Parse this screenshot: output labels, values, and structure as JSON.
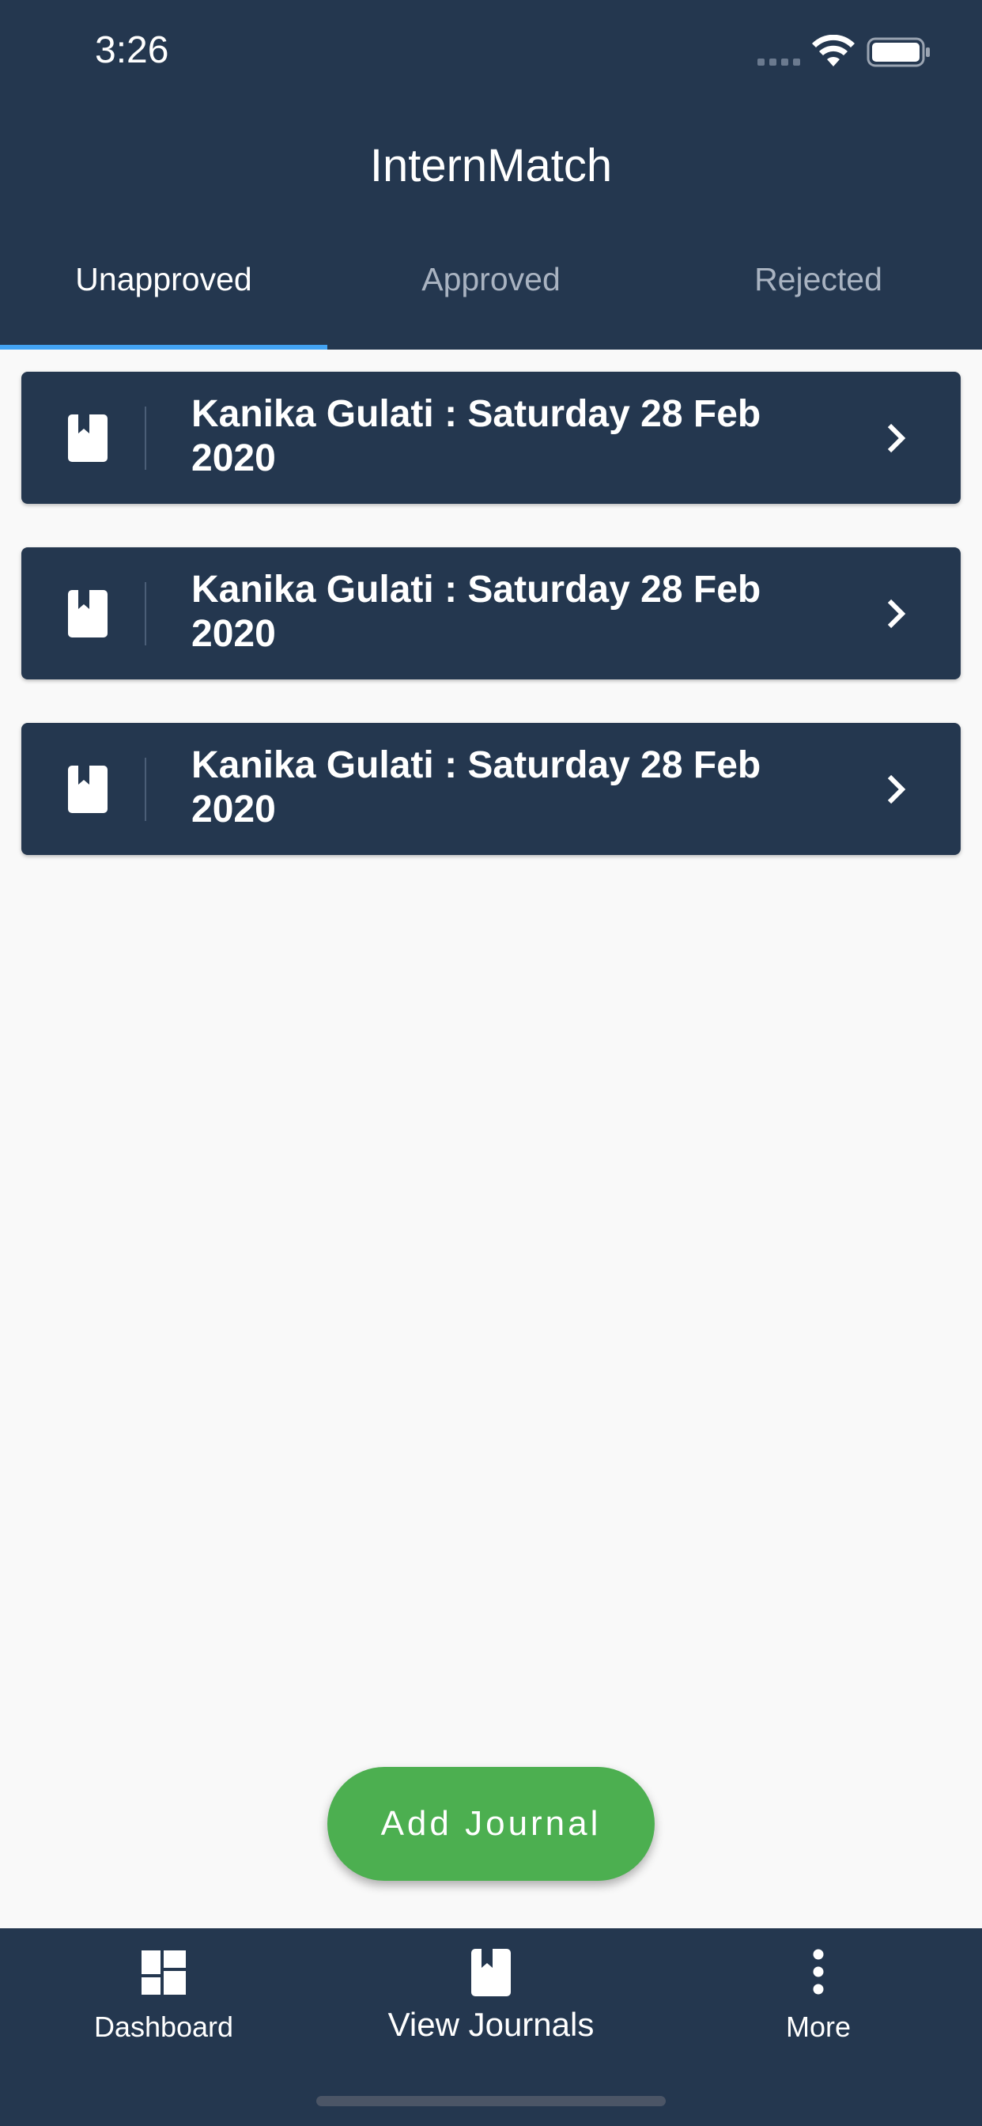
{
  "status_bar": {
    "time": "3:26"
  },
  "header": {
    "title": "InternMatch"
  },
  "tabs": [
    {
      "label": "Unapproved",
      "active": true
    },
    {
      "label": "Approved",
      "active": false
    },
    {
      "label": "Rejected",
      "active": false
    }
  ],
  "journals": [
    {
      "title": "Kanika Gulati : Saturday 28 Feb 2020",
      "icon": "book-icon"
    },
    {
      "title": "Kanika Gulati : Saturday 28 Feb 2020",
      "icon": "book-icon"
    },
    {
      "title": "Kanika Gulati : Saturday 28 Feb 2020",
      "icon": "book-icon"
    }
  ],
  "fab": {
    "label": "Add Journal"
  },
  "bottom_nav": [
    {
      "label": "Dashboard",
      "icon": "dashboard-icon"
    },
    {
      "label": "View Journals",
      "icon": "book-icon"
    },
    {
      "label": "More",
      "icon": "more-vertical-icon"
    }
  ],
  "colors": {
    "primary": "#24374f",
    "accent": "#43a3f3",
    "fab": "#4caf50",
    "background": "#f9f9f9"
  }
}
